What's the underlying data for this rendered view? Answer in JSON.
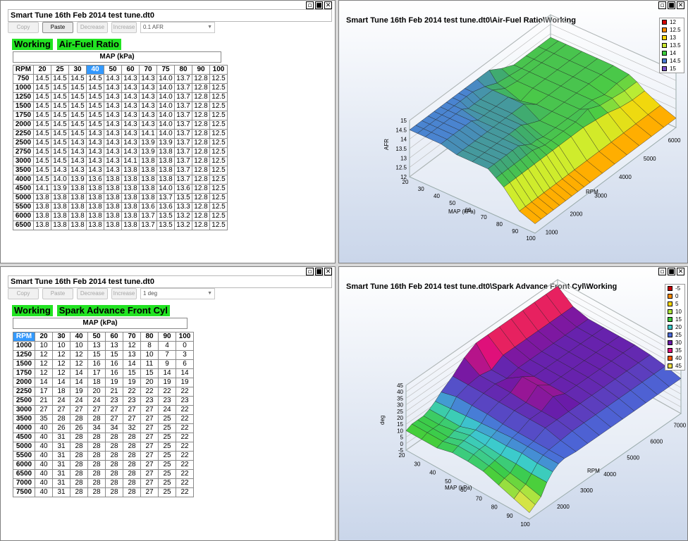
{
  "tables": [
    {
      "title": "Smart Tune 16th Feb 2014 test tune.dt0",
      "buttons": [
        "Copy",
        "Paste",
        "Decrease",
        "Increase"
      ],
      "active_button": 1,
      "step": "0.1 AFR",
      "tags": [
        "Working",
        "Air-Fuel Ratio"
      ],
      "axis_label": "MAP (kPa)",
      "corner": "RPM",
      "cols": [
        "20",
        "25",
        "30",
        "40",
        "50",
        "60",
        "70",
        "75",
        "80",
        "90",
        "100"
      ],
      "selected_col": 3,
      "rows": [
        {
          "rpm": "750",
          "v": [
            "14.5",
            "14.5",
            "14.5",
            "14.5",
            "14.3",
            "14.3",
            "14.3",
            "14.0",
            "13.7",
            "12.8",
            "12.5"
          ]
        },
        {
          "rpm": "1000",
          "v": [
            "14.5",
            "14.5",
            "14.5",
            "14.5",
            "14.3",
            "14.3",
            "14.3",
            "14.0",
            "13.7",
            "12.8",
            "12.5"
          ]
        },
        {
          "rpm": "1250",
          "v": [
            "14.5",
            "14.5",
            "14.5",
            "14.5",
            "14.3",
            "14.3",
            "14.3",
            "14.0",
            "13.7",
            "12.8",
            "12.5"
          ]
        },
        {
          "rpm": "1500",
          "v": [
            "14.5",
            "14.5",
            "14.5",
            "14.5",
            "14.3",
            "14.3",
            "14.3",
            "14.0",
            "13.7",
            "12.8",
            "12.5"
          ]
        },
        {
          "rpm": "1750",
          "v": [
            "14.5",
            "14.5",
            "14.5",
            "14.5",
            "14.3",
            "14.3",
            "14.3",
            "14.0",
            "13.7",
            "12.8",
            "12.5"
          ]
        },
        {
          "rpm": "2000",
          "v": [
            "14.5",
            "14.5",
            "14.5",
            "14.5",
            "14.3",
            "14.3",
            "14.3",
            "14.0",
            "13.7",
            "12.8",
            "12.5"
          ]
        },
        {
          "rpm": "2250",
          "v": [
            "14.5",
            "14.5",
            "14.5",
            "14.3",
            "14.3",
            "14.3",
            "14.1",
            "14.0",
            "13.7",
            "12.8",
            "12.5"
          ]
        },
        {
          "rpm": "2500",
          "v": [
            "14.5",
            "14.5",
            "14.3",
            "14.3",
            "14.3",
            "14.3",
            "13.9",
            "13.9",
            "13.7",
            "12.8",
            "12.5"
          ]
        },
        {
          "rpm": "2750",
          "v": [
            "14.5",
            "14.5",
            "14.3",
            "14.3",
            "14.3",
            "14.3",
            "13.9",
            "13.8",
            "13.7",
            "12.8",
            "12.5"
          ]
        },
        {
          "rpm": "3000",
          "v": [
            "14.5",
            "14.5",
            "14.3",
            "14.3",
            "14.3",
            "14.1",
            "13.8",
            "13.8",
            "13.7",
            "12.8",
            "12.5"
          ]
        },
        {
          "rpm": "3500",
          "v": [
            "14.5",
            "14.3",
            "14.3",
            "14.3",
            "14.3",
            "13.8",
            "13.8",
            "13.8",
            "13.7",
            "12.8",
            "12.5"
          ]
        },
        {
          "rpm": "4000",
          "v": [
            "14.5",
            "14.0",
            "13.9",
            "13.6",
            "13.8",
            "13.8",
            "13.8",
            "13.8",
            "13.7",
            "12.8",
            "12.5"
          ]
        },
        {
          "rpm": "4500",
          "v": [
            "14.1",
            "13.9",
            "13.8",
            "13.8",
            "13.8",
            "13.8",
            "13.8",
            "14.0",
            "13.6",
            "12.8",
            "12.5"
          ]
        },
        {
          "rpm": "5000",
          "v": [
            "13.8",
            "13.8",
            "13.8",
            "13.8",
            "13.8",
            "13.8",
            "13.8",
            "13.7",
            "13.5",
            "12.8",
            "12.5"
          ]
        },
        {
          "rpm": "5500",
          "v": [
            "13.8",
            "13.8",
            "13.8",
            "13.8",
            "13.8",
            "13.8",
            "13.6",
            "13.6",
            "13.3",
            "12.8",
            "12.5"
          ]
        },
        {
          "rpm": "6000",
          "v": [
            "13.8",
            "13.8",
            "13.8",
            "13.8",
            "13.8",
            "13.8",
            "13.7",
            "13.5",
            "13.2",
            "12.8",
            "12.5"
          ]
        },
        {
          "rpm": "6500",
          "v": [
            "13.8",
            "13.8",
            "13.8",
            "13.8",
            "13.8",
            "13.8",
            "13.7",
            "13.5",
            "13.2",
            "12.8",
            "12.5"
          ]
        }
      ]
    },
    {
      "title": "Smart Tune 16th Feb 2014 test tune.dt0",
      "buttons": [
        "Copy",
        "Paste",
        "Decrease",
        "Increase"
      ],
      "active_button": -1,
      "step": "1 deg",
      "tags": [
        "Working",
        "Spark Advance Front Cyl"
      ],
      "axis_label": "MAP (kPa)",
      "corner": "RPM",
      "cols": [
        "20",
        "30",
        "40",
        "50",
        "60",
        "70",
        "80",
        "90",
        "100"
      ],
      "selected_col": -1,
      "rows": [
        {
          "rpm": "1000",
          "v": [
            "10",
            "10",
            "10",
            "13",
            "13",
            "12",
            "8",
            "4",
            "0"
          ]
        },
        {
          "rpm": "1250",
          "v": [
            "12",
            "12",
            "12",
            "15",
            "15",
            "13",
            "10",
            "7",
            "3"
          ]
        },
        {
          "rpm": "1500",
          "v": [
            "12",
            "12",
            "12",
            "16",
            "16",
            "14",
            "11",
            "9",
            "6"
          ]
        },
        {
          "rpm": "1750",
          "v": [
            "12",
            "12",
            "14",
            "17",
            "16",
            "15",
            "15",
            "14",
            "14"
          ]
        },
        {
          "rpm": "2000",
          "v": [
            "14",
            "14",
            "14",
            "18",
            "19",
            "19",
            "20",
            "19",
            "19"
          ]
        },
        {
          "rpm": "2250",
          "v": [
            "17",
            "18",
            "19",
            "20",
            "21",
            "22",
            "22",
            "22",
            "22"
          ]
        },
        {
          "rpm": "2500",
          "v": [
            "21",
            "24",
            "24",
            "24",
            "23",
            "23",
            "23",
            "23",
            "23"
          ]
        },
        {
          "rpm": "3000",
          "v": [
            "27",
            "27",
            "27",
            "27",
            "27",
            "27",
            "27",
            "24",
            "22"
          ]
        },
        {
          "rpm": "3500",
          "v": [
            "35",
            "28",
            "28",
            "28",
            "27",
            "27",
            "27",
            "25",
            "22"
          ]
        },
        {
          "rpm": "4000",
          "v": [
            "40",
            "26",
            "26",
            "34",
            "34",
            "32",
            "27",
            "25",
            "22"
          ]
        },
        {
          "rpm": "4500",
          "v": [
            "40",
            "31",
            "28",
            "28",
            "28",
            "28",
            "27",
            "25",
            "22"
          ]
        },
        {
          "rpm": "5000",
          "v": [
            "40",
            "31",
            "28",
            "28",
            "28",
            "28",
            "27",
            "25",
            "22"
          ]
        },
        {
          "rpm": "5500",
          "v": [
            "40",
            "31",
            "28",
            "28",
            "28",
            "28",
            "27",
            "25",
            "22"
          ]
        },
        {
          "rpm": "6000",
          "v": [
            "40",
            "31",
            "28",
            "28",
            "28",
            "28",
            "27",
            "25",
            "22"
          ]
        },
        {
          "rpm": "6500",
          "v": [
            "40",
            "31",
            "28",
            "28",
            "28",
            "28",
            "27",
            "25",
            "22"
          ]
        },
        {
          "rpm": "7000",
          "v": [
            "40",
            "31",
            "28",
            "28",
            "28",
            "28",
            "27",
            "25",
            "22"
          ]
        },
        {
          "rpm": "7500",
          "v": [
            "40",
            "31",
            "28",
            "28",
            "28",
            "28",
            "27",
            "25",
            "22"
          ]
        }
      ]
    }
  ],
  "charts": [
    {
      "title": "Smart Tune 16th Feb 2014 test tune.dt0\\Air-Fuel Ratio\\Working",
      "zlabel": "AFR",
      "xlabel": "MAP (kPa)",
      "ylabel": "RPM",
      "zticks": [
        "15",
        "14.5",
        "14",
        "13.5",
        "13",
        "12.5",
        "12"
      ],
      "xticks": [
        "20",
        "30",
        "40",
        "50",
        "60",
        "70",
        "80",
        "90",
        "100"
      ],
      "yticks": [
        "1000",
        "2000",
        "3000",
        "4000",
        "5000",
        "6000"
      ],
      "legend": [
        {
          "label": "12",
          "color": "#d40000"
        },
        {
          "label": "12.5",
          "color": "#ff8c00"
        },
        {
          "label": "13",
          "color": "#ffd700"
        },
        {
          "label": "13.5",
          "color": "#c8e632"
        },
        {
          "label": "14",
          "color": "#3ccc3c"
        },
        {
          "label": "14.5",
          "color": "#4a78d0"
        },
        {
          "label": "15",
          "color": "#7a50c8"
        }
      ]
    },
    {
      "title": "Smart Tune 16th Feb 2014 test tune.dt0\\Spark Advance Front Cyl\\Working",
      "zlabel": "deg",
      "xlabel": "MAP (kPa)",
      "ylabel": "RPM",
      "zticks": [
        "45",
        "40",
        "35",
        "30",
        "25",
        "20",
        "15",
        "10",
        "5",
        "0",
        "-5"
      ],
      "xticks": [
        "20",
        "30",
        "40",
        "50",
        "60",
        "70",
        "80",
        "90",
        "100"
      ],
      "yticks": [
        "2000",
        "3000",
        "4000",
        "5000",
        "6000",
        "7000"
      ],
      "legend": [
        {
          "label": "-5",
          "color": "#c80000"
        },
        {
          "label": "0",
          "color": "#ff8c00"
        },
        {
          "label": "5",
          "color": "#ffd700"
        },
        {
          "label": "10",
          "color": "#aee63c"
        },
        {
          "label": "15",
          "color": "#3ccc3c"
        },
        {
          "label": "20",
          "color": "#3ccccc"
        },
        {
          "label": "25",
          "color": "#4a6ad8"
        },
        {
          "label": "30",
          "color": "#6a1aa8"
        },
        {
          "label": "35",
          "color": "#e0107a"
        },
        {
          "label": "40",
          "color": "#ff5a00"
        },
        {
          "label": "45",
          "color": "#f0e040"
        }
      ]
    }
  ]
}
